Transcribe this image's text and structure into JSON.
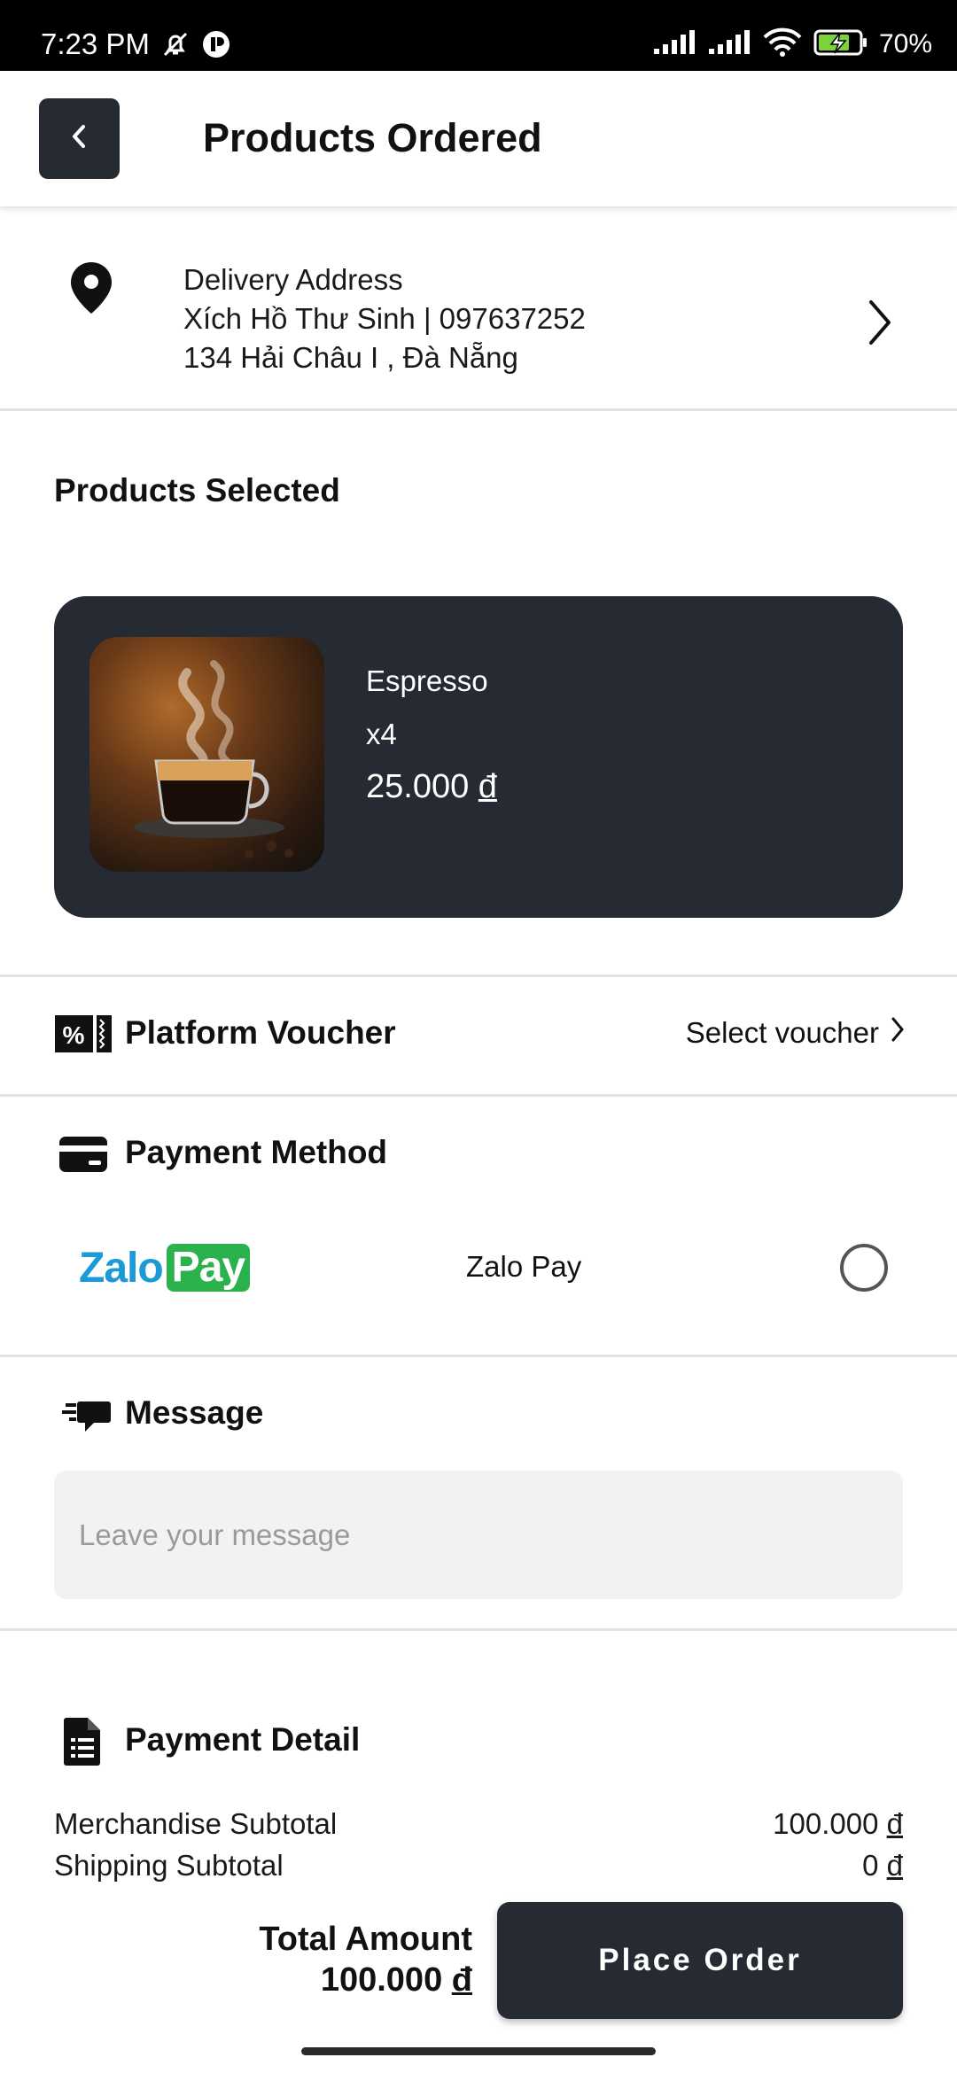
{
  "status_bar": {
    "time": "7:23 PM",
    "battery": "70%",
    "icons": [
      "mute-bell-icon",
      "app-notification-icon",
      "signal-icon",
      "signal-icon",
      "wifi-icon",
      "battery-charging-icon"
    ]
  },
  "header": {
    "back_icon": "chevron-left-icon",
    "title": "Products Ordered"
  },
  "address": {
    "icon": "location-pin-icon",
    "label": "Delivery Address",
    "name_phone": "Xích Hồ Thư Sinh | 097637252",
    "street": "134 Hải Châu I , Đà Nẵng",
    "chevron_icon": "chevron-right-icon"
  },
  "products": {
    "title": "Products Selected",
    "items": [
      {
        "name": "Espresso",
        "quantity": "x4",
        "price_value": "25.000",
        "currency": "đ",
        "image": "espresso-cup-photo"
      }
    ]
  },
  "voucher": {
    "icon": "voucher-ticket-icon",
    "title": "Platform Voucher",
    "link": "Select voucher"
  },
  "payment_method": {
    "icon": "credit-card-icon",
    "title": "Payment Method",
    "options": [
      {
        "logo_left": "Zalo",
        "logo_right": "Pay",
        "label": "Zalo Pay",
        "selected": false
      }
    ]
  },
  "message": {
    "icon": "chat-bubble-icon",
    "title": "Message",
    "value": "",
    "placeholder": "Leave your message"
  },
  "payment_detail": {
    "icon": "document-list-icon",
    "title": "Payment Detail",
    "rows": [
      {
        "label": "Merchandise Subtotal",
        "value": "100.000",
        "currency": "đ"
      },
      {
        "label": "Shipping Subtotal",
        "value": "0",
        "currency": "đ"
      }
    ]
  },
  "footer": {
    "total_label": "Total Amount",
    "total_value": "100.000",
    "currency": "đ",
    "place_order_label": "Place Order"
  },
  "colors": {
    "dark": "#252a33",
    "divider": "#e3e3e3",
    "zalo_blue": "#1a9ad6",
    "zalo_green": "#2bb24c"
  }
}
